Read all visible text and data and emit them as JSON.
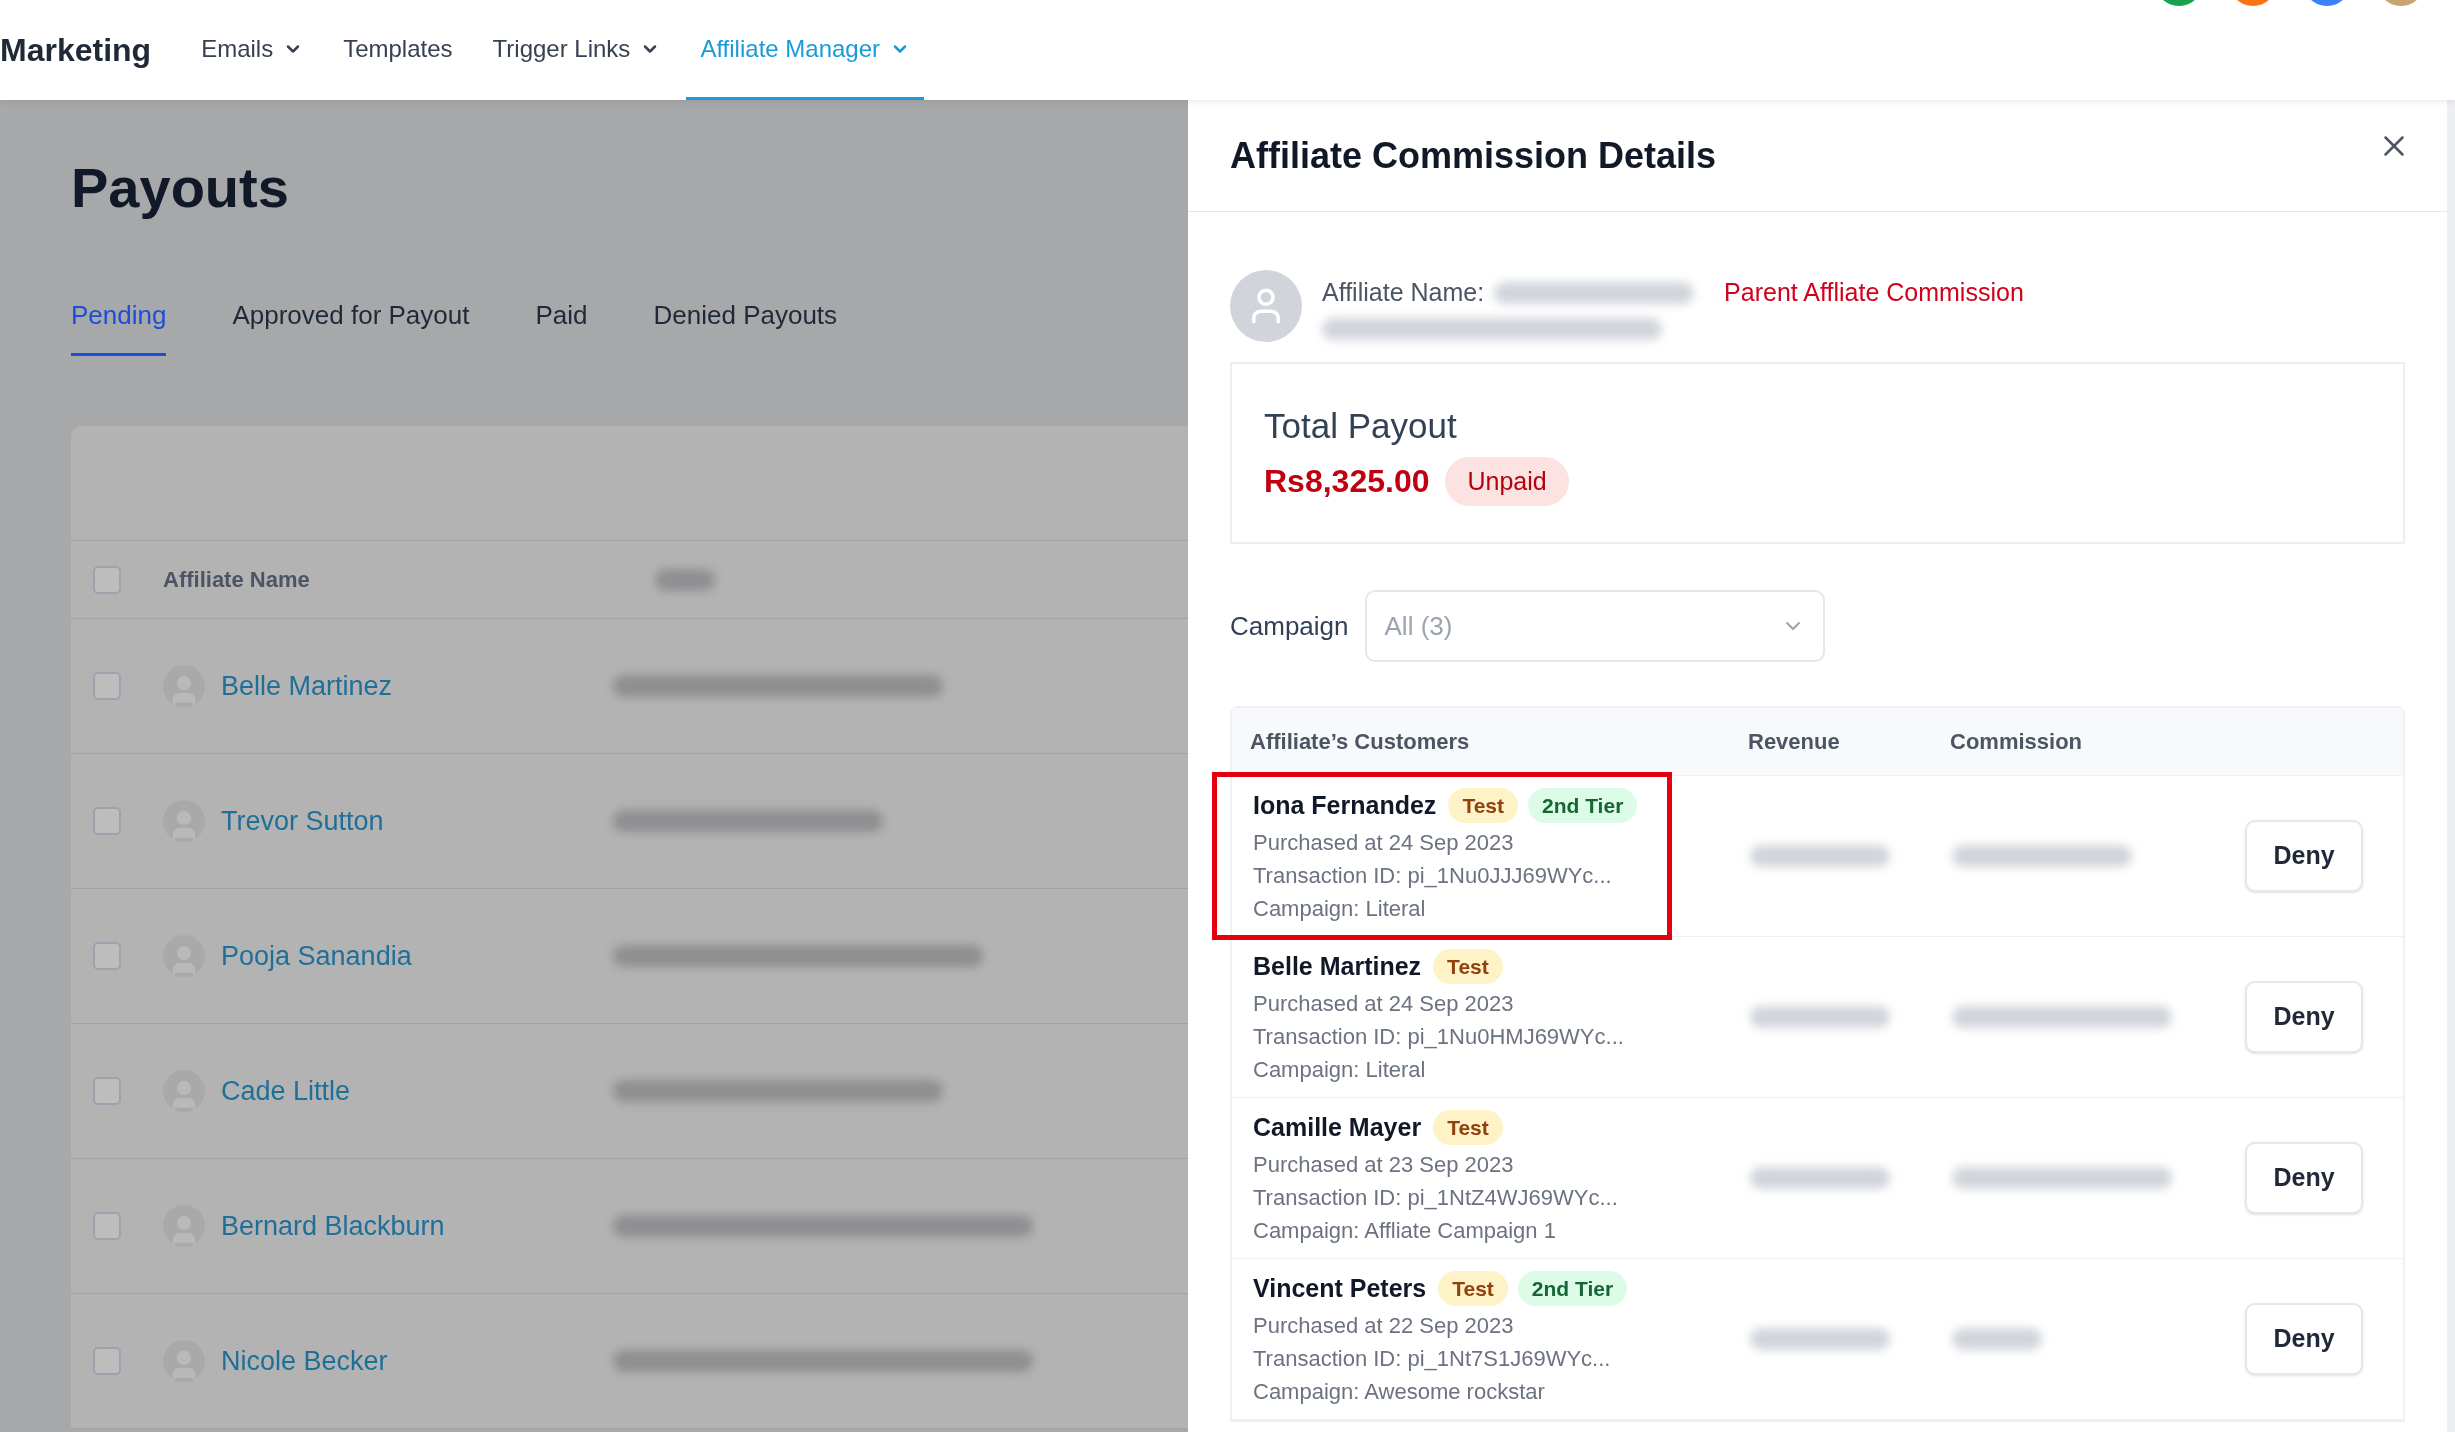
{
  "nav": {
    "brand": "Marketing",
    "items": [
      {
        "label": "Emails",
        "dropdown": true,
        "selected": false
      },
      {
        "label": "Templates",
        "dropdown": false,
        "selected": false
      },
      {
        "label": "Trigger Links",
        "dropdown": true,
        "selected": false
      },
      {
        "label": "Affiliate Manager",
        "dropdown": true,
        "selected": true
      }
    ],
    "avatars": [
      {
        "color": "#16a34a"
      },
      {
        "color": "#f97316"
      },
      {
        "color": "#3b82f6"
      },
      {
        "color": "#c8a46e"
      }
    ]
  },
  "page": {
    "title": "Payouts",
    "tabs": [
      {
        "label": "Pending",
        "selected": true
      },
      {
        "label": "Approved for Payout",
        "selected": false
      },
      {
        "label": "Paid",
        "selected": false
      },
      {
        "label": "Denied Payouts",
        "selected": false
      }
    ],
    "table": {
      "columns": [
        "Affiliate Name"
      ],
      "select_all_checked": false,
      "rows": [
        {
          "name": "Belle Martinez",
          "checked": false
        },
        {
          "name": "Trevor Sutton",
          "checked": false
        },
        {
          "name": "Pooja Sanandia",
          "checked": false
        },
        {
          "name": "Cade Little",
          "checked": false
        },
        {
          "name": "Bernard Blackburn",
          "checked": false
        },
        {
          "name": "Nicole Becker",
          "checked": false
        }
      ]
    }
  },
  "drawer": {
    "title": "Affiliate Commission Details",
    "affiliate_label": "Affiliate Name:",
    "parent_link": "Parent Affliate Commission",
    "total": {
      "label": "Total Payout",
      "amount": "Rs8,325.00",
      "status": "Unpaid"
    },
    "campaign": {
      "label": "Campaign",
      "placeholder": "All (3)"
    },
    "columns": [
      "Affiliate’s Customers",
      "Revenue",
      "Commission"
    ],
    "rows": [
      {
        "name": "Iona Fernandez",
        "highlighted": true,
        "badges": [
          {
            "label": "Test",
            "kind": "test"
          },
          {
            "label": "2nd Tier",
            "kind": "tier"
          }
        ],
        "purchased": "Purchased at 24 Sep 2023",
        "transaction": "Transaction ID: pi_1Nu0JJJ69WYc...",
        "campaign": "Campaign: Literal",
        "action": "Deny"
      },
      {
        "name": "Belle Martinez",
        "highlighted": false,
        "badges": [
          {
            "label": "Test",
            "kind": "test"
          }
        ],
        "purchased": "Purchased at 24 Sep 2023",
        "transaction": "Transaction ID: pi_1Nu0HMJ69WYc...",
        "campaign": "Campaign: Literal",
        "action": "Deny"
      },
      {
        "name": "Camille Mayer",
        "highlighted": false,
        "badges": [
          {
            "label": "Test",
            "kind": "test"
          }
        ],
        "purchased": "Purchased at 23 Sep 2023",
        "transaction": "Transaction ID: pi_1NtZ4WJ69WYc...",
        "campaign": "Campaign: Affliate Campaign 1",
        "action": "Deny"
      },
      {
        "name": "Vincent Peters",
        "highlighted": false,
        "badges": [
          {
            "label": "Test",
            "kind": "test"
          },
          {
            "label": "2nd Tier",
            "kind": "tier"
          }
        ],
        "purchased": "Purchased at 22 Sep 2023",
        "transaction": "Transaction ID: pi_1Nt7S1J69WYc...",
        "campaign": "Campaign: Awesome rockstar",
        "action": "Deny"
      }
    ]
  }
}
